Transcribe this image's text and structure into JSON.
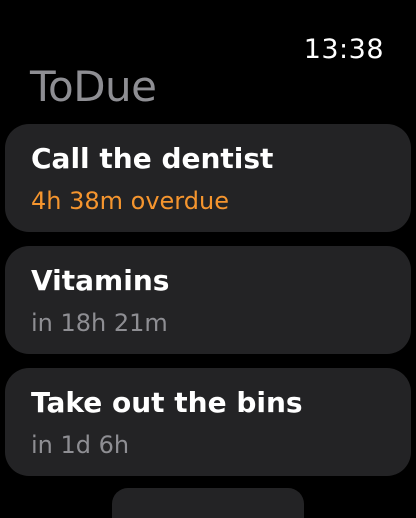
{
  "status_bar": {
    "time": "13:38"
  },
  "app": {
    "title": "ToDue"
  },
  "colors": {
    "background": "#000000",
    "card": "#232325",
    "title_gray": "#8e8e93",
    "overdue_orange": "#f5952e",
    "secondary_text": "#8e8e93"
  },
  "tasks": [
    {
      "title": "Call the dentist",
      "status": "4h 38m overdue",
      "overdue": true
    },
    {
      "title": "Vitamins",
      "status": "in 18h 21m",
      "overdue": false
    },
    {
      "title": "Take out the bins",
      "status": "in 1d 6h",
      "overdue": false
    }
  ]
}
